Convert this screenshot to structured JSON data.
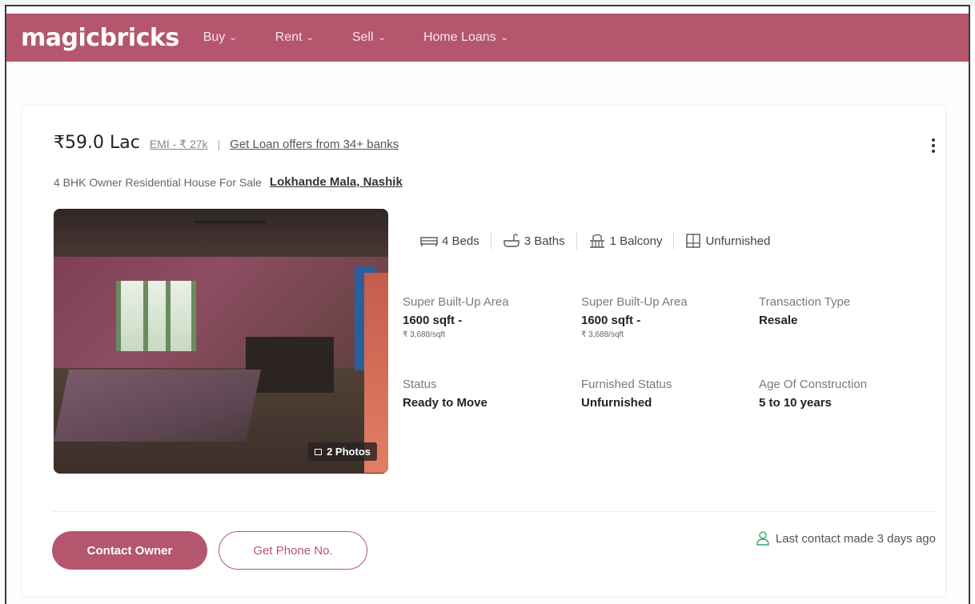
{
  "nav": {
    "logo": "magicbricks",
    "items": [
      {
        "label": "Buy"
      },
      {
        "label": "Rent"
      },
      {
        "label": "Sell"
      },
      {
        "label": "Home Loans"
      }
    ]
  },
  "listing": {
    "price": "₹59.0 Lac",
    "emi": "EMI - ₹ 27k",
    "separator": "|",
    "loan_offer": "Get Loan offers from 34+ banks",
    "title": "4 BHK Owner Residential House For Sale",
    "location": "Lokhande Mala, Nashik",
    "photo_count": "2 Photos",
    "amenities": [
      {
        "icon": "bed-icon",
        "label": "4 Beds"
      },
      {
        "icon": "bath-icon",
        "label": "3 Baths"
      },
      {
        "icon": "balcony-icon",
        "label": "1 Balcony"
      },
      {
        "icon": "furniture-icon",
        "label": "Unfurnished"
      }
    ],
    "details": [
      {
        "label": "Super Built-Up Area",
        "value": "1600 sqft -",
        "sub": "₹ 3,688/sqft"
      },
      {
        "label": "Super Built-Up Area",
        "value": "1600 sqft -",
        "sub": "₹ 3,688/sqft"
      },
      {
        "label": "Transaction Type",
        "value": "Resale",
        "sub": ""
      },
      {
        "label": "Status",
        "value": "Ready to Move",
        "sub": ""
      },
      {
        "label": "Furnished Status",
        "value": "Unfurnished",
        "sub": ""
      },
      {
        "label": "Age Of Construction",
        "value": "5 to 10 years",
        "sub": ""
      }
    ],
    "contact_button": "Contact Owner",
    "phone_button": "Get Phone No.",
    "last_contact": "Last contact made 3 days ago"
  },
  "colors": {
    "brand": "#b4566e",
    "success": "#3aa66a"
  }
}
